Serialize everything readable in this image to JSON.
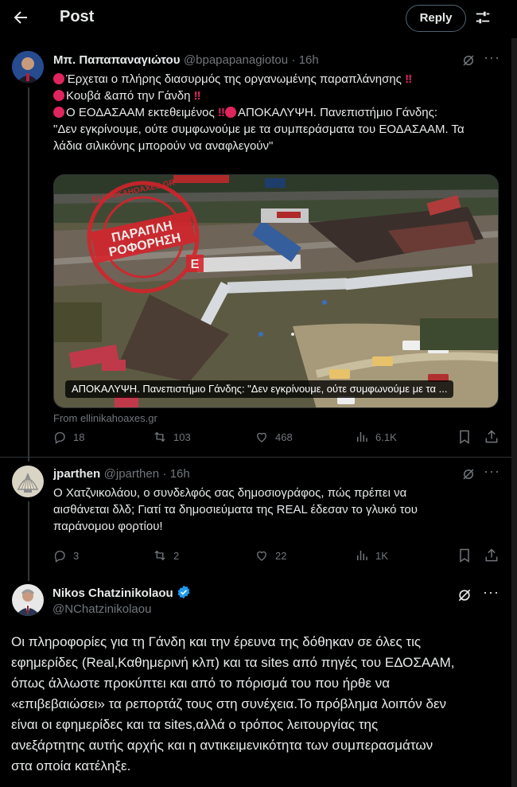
{
  "header": {
    "title": "Post",
    "reply_label": "Reply"
  },
  "tweets": [
    {
      "name": "Μπ. Παπαπαναγιώτου",
      "handle": "@bpapapanagiotou",
      "time": "· 16h",
      "lines": {
        "l1": "Έρχεται ο πλήρης διασυρμός της οργανωμένης παραπλάνησης",
        "l1_end": "‼",
        "l2": "Κουβά &από την Γάνδη",
        "l2_end": "‼",
        "l3a": "Ο ΕΟΔΑΣΑΑΜ εκτεθειμένος",
        "l3_mid": "‼",
        "l3b": "ΑΠΟΚΑΛΥΨΗ. Πανεπιστήμιο Γάνδης:",
        "l4": "\"Δεν εγκρίνουμε, ούτε συμφωνούμε με τα συμπεράσματα του ΕΟΔΑΣΑΑΜ. Τα",
        "l5": "λάδια σιλικόνης μπορούν να αναφλεγούν\""
      },
      "media": {
        "caption": "ΑΠΟΚΑΛΥΨΗ. Πανεπιστήμιο Γάνδης: \"Δεν εγκρίνουμε, ούτε συμφωνούμε με τα ...",
        "stamp_line1": "ΠΑΡΑΠΛΗ",
        "stamp_line2": "ΡΟΦΟΡΗΣΗ",
        "stamp_ring": "ELLINIKAHOAXES.GR"
      },
      "from": "From ellinikahoaxes.gr",
      "stats": {
        "replies": "18",
        "reposts": "103",
        "likes": "468",
        "views": "6.1K"
      }
    },
    {
      "name": "jparthen",
      "handle": "@jparthen",
      "time": "· 16h",
      "lines": {
        "l1": "Ο Χατζνικολάου, ο συνδελφός σας δημοσιογράφος, πώς πρέπει να",
        "l2": "αισθάνεται δλδ; Γιατί τα δημοσιεύματα της REAL έδεσαν το γλυκό του",
        "l3": "παράνομου φορτίου!"
      },
      "stats": {
        "replies": "3",
        "reposts": "2",
        "likes": "22",
        "views": "1K"
      }
    },
    {
      "name": "Nikos Chatzinikolaou",
      "handle": "@NChatzinikolaou",
      "verified": true,
      "lines": {
        "l1": "Οι πληροφορίες για τη Γάνδη και την έρευνα της δόθηκαν σε όλες τις",
        "l2": "εφημερίδες (Real,Καθημερινή κλπ) και τα sites από πηγές του ΕΔΟΣΑΑΜ,",
        "l3": "όπως άλλωστε προκύπτει και από το πόρισμά του που ήρθε να",
        "l4": "«επιβεβαιώσει» τα ρεπορτάζ τους στη συνέχεια.Το πρόβλημα λοιπόν δεν",
        "l5": "είναι οι εφημερίδες και τα sites,αλλά ο τρόπος λειτουργίας της",
        "l6": "ανεξάρτητης αυτής αρχής και η αντικειμενικότητα των συμπερασμάτων",
        "l7": "στα οποία κατέληξε."
      }
    }
  ],
  "colors": {
    "background": "#000000",
    "text": "#e7e9ea",
    "muted": "#71767b",
    "accent_red": "#e0245e",
    "verified_blue": "#1d9bf0"
  },
  "icons": [
    "back-arrow-icon",
    "settings-sliders-icon",
    "grok-icon",
    "more-icon",
    "reply-icon",
    "repost-icon",
    "like-icon",
    "views-icon",
    "bookmark-icon",
    "share-icon",
    "verified-badge-icon"
  ]
}
